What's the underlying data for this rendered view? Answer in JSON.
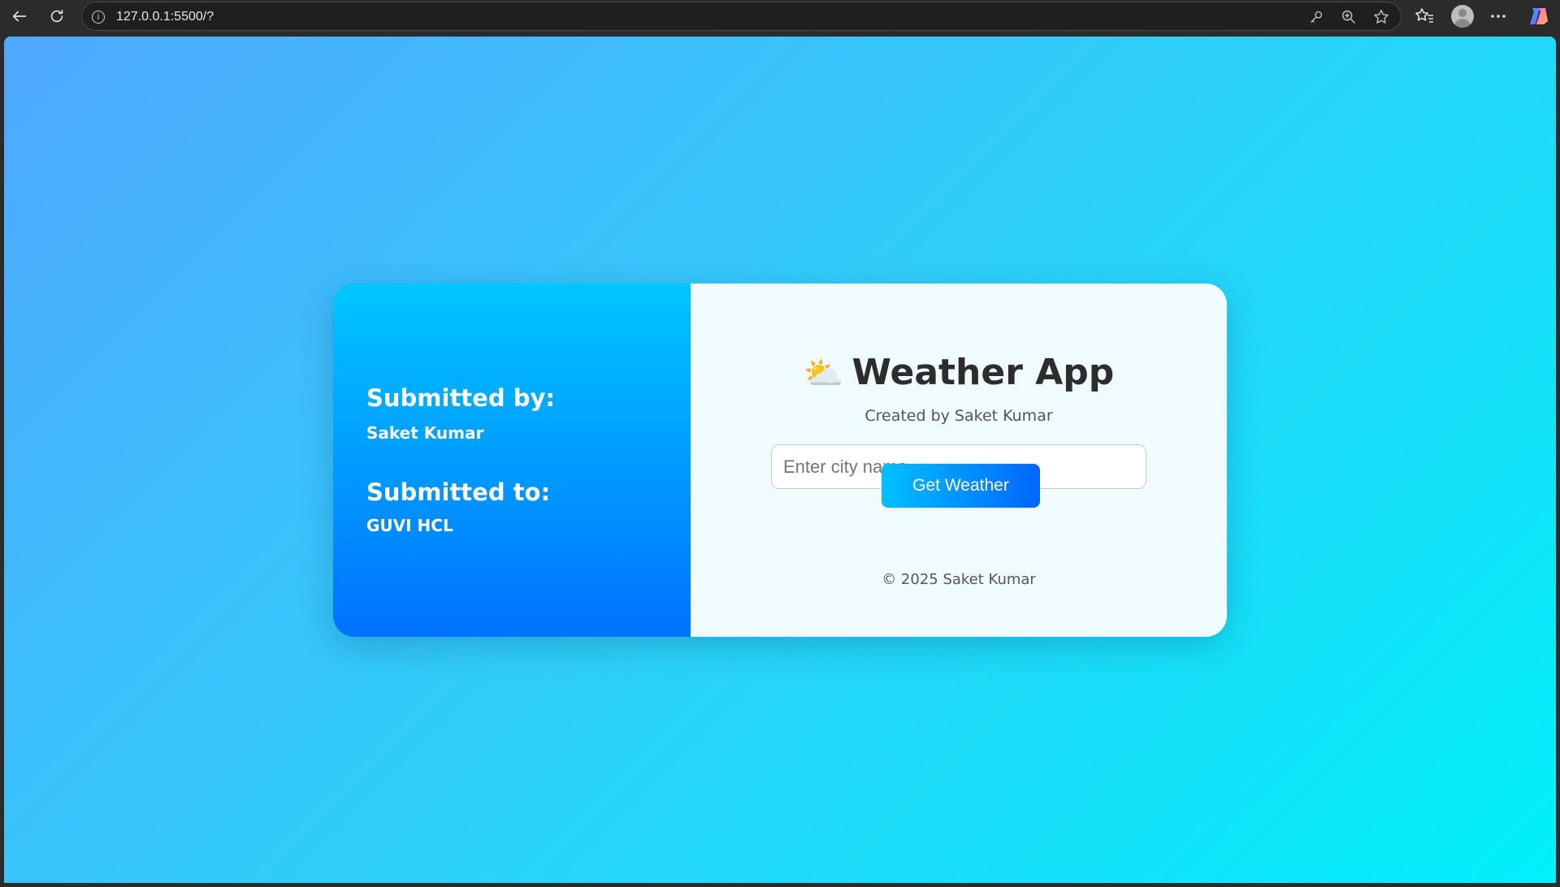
{
  "browser": {
    "url": "127.0.0.1:5500/?",
    "icons": [
      "back-icon",
      "reload-icon",
      "info-icon",
      "key-icon",
      "zoom-icon",
      "star-icon",
      "favorites-icon",
      "profile-icon",
      "more-icon",
      "copilot-icon"
    ]
  },
  "card": {
    "submitted_by_label": "Submitted by:",
    "submitted_by_value": "Saket Kumar",
    "submitted_to_label": "Submitted to:",
    "submitted_to_value": "GUVI HCL"
  },
  "app": {
    "icon": "⛅",
    "title": "Weather App",
    "subtitle": "Created by Saket Kumar",
    "city_placeholder": "Enter city name",
    "city_value": "",
    "button_label": "Get Weather",
    "footer": "© 2025 Saket Kumar"
  },
  "colors": {
    "bg_gradient_start": "#4fa8ff",
    "bg_gradient_end": "#00f0fb",
    "panel_gradient_top": "#00c6ff",
    "panel_gradient_bottom": "#0072ff",
    "right_panel": "#f0fbff",
    "button_gradient_start": "#00c0ff",
    "button_gradient_end": "#0066ff"
  }
}
